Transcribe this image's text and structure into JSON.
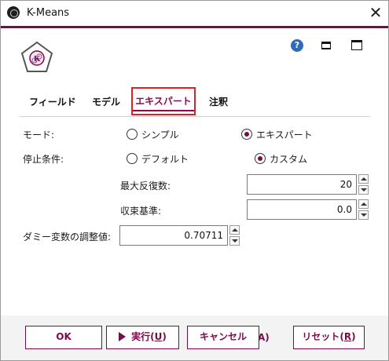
{
  "window": {
    "title": "K-Means"
  },
  "tabs": [
    {
      "label": "フィールド"
    },
    {
      "label": "モデル"
    },
    {
      "label": "エキスパート"
    },
    {
      "label": "注釈"
    }
  ],
  "form": {
    "mode": {
      "label": "モード:",
      "options": [
        {
          "label": "シンプル",
          "checked": false
        },
        {
          "label": "エキスパート",
          "checked": true
        }
      ]
    },
    "stop_condition": {
      "label": "停止条件:",
      "options": [
        {
          "label": "デフォルト",
          "checked": false
        },
        {
          "label": "カスタム",
          "checked": true
        }
      ]
    },
    "max_iterations": {
      "label": "最大反復数:",
      "value": "20"
    },
    "convergence": {
      "label": "収束基準:",
      "value": "0.0"
    },
    "dummy_adjust": {
      "label": "ダミー変数の調整値:",
      "value": "0.70711"
    }
  },
  "buttons": {
    "ok": "OK",
    "run_prefix": "実行(",
    "run_key": "U",
    "run_suffix": ")",
    "cancel": "キャンセル",
    "stray_text": "A)",
    "reset_prefix": "リセット(",
    "reset_key": "R",
    "reset_suffix": ")"
  },
  "colors": {
    "accent": "#7a0a4a",
    "highlight_border": "#d8232a",
    "help_blue": "#2f6db8"
  },
  "icons": [
    "app-icon",
    "close-icon",
    "kmeans-logo-icon",
    "help-icon",
    "minimize-icon",
    "maximize-icon",
    "run-play-icon",
    "spin-up-icon",
    "spin-down-icon"
  ]
}
